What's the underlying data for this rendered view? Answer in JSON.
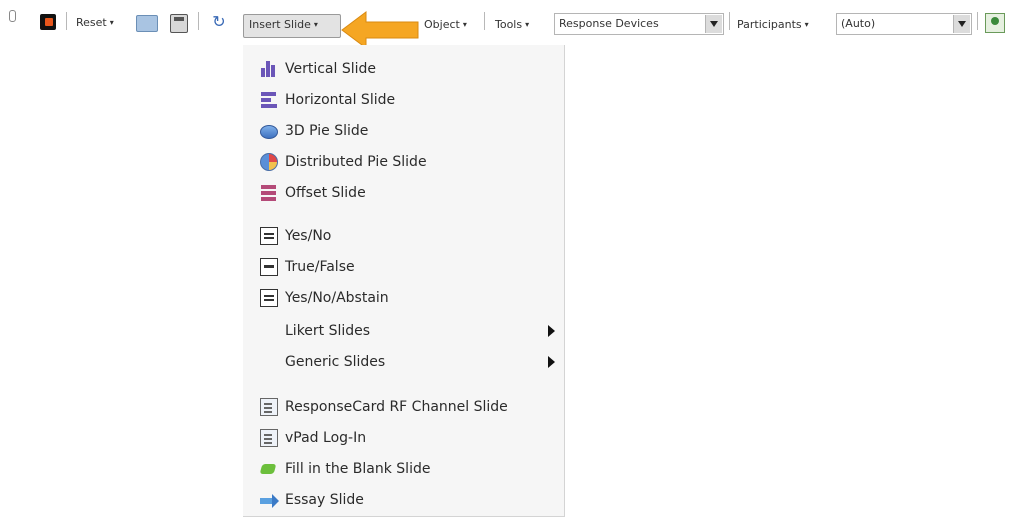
{
  "toolbar": {
    "reset_label": "Reset",
    "insert_slide_label": "Insert Slide",
    "object_label": "Object",
    "tools_label": "Tools",
    "response_devices_value": "Response Devices",
    "participants_label": "Participants",
    "participants_value": "(Auto)",
    "caret": "▾"
  },
  "annotation_color": "#f5a623",
  "menu": {
    "groups": [
      {
        "items": [
          {
            "label": "Vertical Slide",
            "icon": "vertical-bar-chart-icon"
          },
          {
            "label": "Horizontal Slide",
            "icon": "horizontal-bar-chart-icon"
          },
          {
            "label": "3D Pie Slide",
            "icon": "3d-pie-chart-icon"
          },
          {
            "label": "Distributed Pie Slide",
            "icon": "distributed-pie-chart-icon"
          },
          {
            "label": "Offset Slide",
            "icon": "offset-bar-chart-icon"
          }
        ]
      },
      {
        "items": [
          {
            "label": "Yes/No",
            "icon": "text-box-icon"
          },
          {
            "label": "True/False",
            "icon": "text-box-icon"
          },
          {
            "label": "Yes/No/Abstain",
            "icon": "text-box-icon"
          },
          {
            "label": "Likert Slides",
            "icon": null,
            "submenu": true
          },
          {
            "label": "Generic Slides",
            "icon": null,
            "submenu": true
          }
        ]
      },
      {
        "items": [
          {
            "label": "ResponseCard RF Channel Slide",
            "icon": "response-card-icon"
          },
          {
            "label": "vPad Log-In",
            "icon": "vpad-icon"
          },
          {
            "label": "Fill in the Blank Slide",
            "icon": "fill-in-blank-icon"
          },
          {
            "label": "Essay Slide",
            "icon": "essay-arrow-icon"
          }
        ]
      }
    ]
  }
}
